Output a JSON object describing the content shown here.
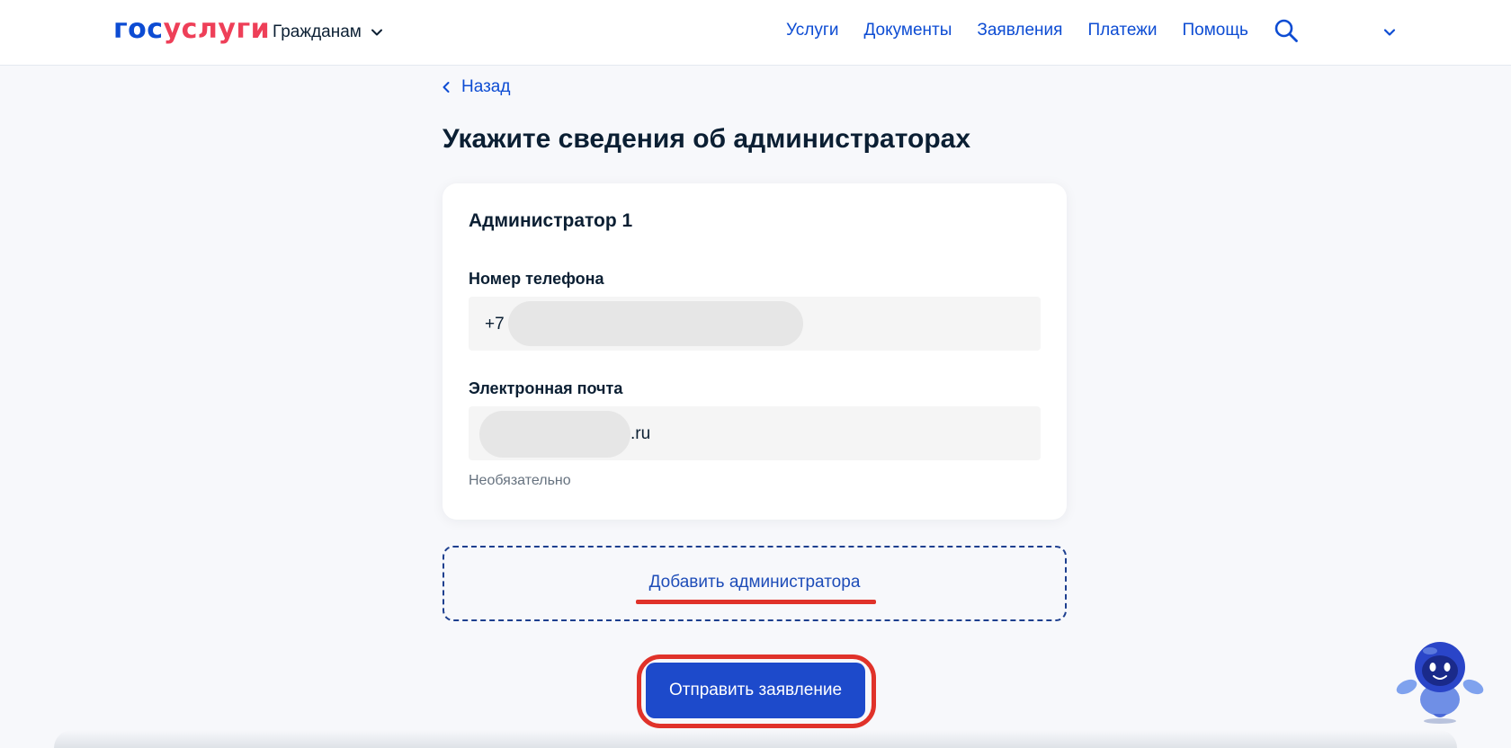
{
  "header": {
    "logo_part1": "гос",
    "logo_part2": "услуги",
    "audience_menu_label": "Гражданам",
    "nav": [
      "Услуги",
      "Документы",
      "Заявления",
      "Платежи",
      "Помощь"
    ]
  },
  "main": {
    "back_label": "Назад",
    "page_title": "Укажите сведения об администраторах",
    "card": {
      "title": "Администратор 1",
      "phone_label": "Номер телефона",
      "phone_prefix": "+7",
      "email_label": "Электронная почта",
      "email_suffix": ".ru",
      "email_hint": "Необязательно"
    },
    "add_admin_label": "Добавить администратора",
    "submit_label": "Отправить заявление"
  },
  "colors": {
    "brand_blue": "#0d4cd3",
    "brand_red": "#ee3f58",
    "button_blue": "#1d4acb",
    "annotation_red": "#e0322a"
  },
  "icons": [
    "chevron-down-icon",
    "search-icon",
    "chevron-left-icon",
    "assistant-robot-icon"
  ]
}
